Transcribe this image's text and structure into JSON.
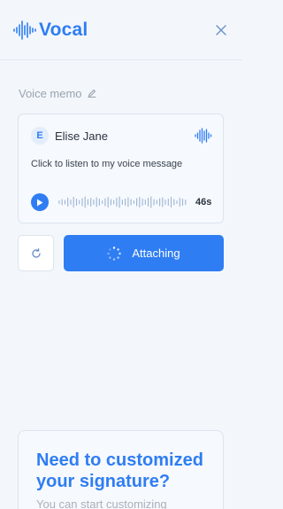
{
  "app": {
    "name": "Vocal"
  },
  "memo": {
    "label": "Voice memo"
  },
  "message_card": {
    "avatar_initial": "E",
    "sender_name": "Elise Jane",
    "message_text": "Click to listen to my voice message",
    "duration": "46s"
  },
  "actions": {
    "attach_label": "Attaching"
  },
  "promo": {
    "title": "Need to customized your signature?",
    "subtitle": "You can start customizing"
  },
  "colors": {
    "accent": "#2f7df3",
    "background": "#f3f7fc",
    "border": "#dde4ed",
    "muted_text": "#9aa3ae"
  },
  "icons": {
    "logo": "waveform-logo-icon",
    "close": "close-icon",
    "edit": "pencil-icon",
    "card_wave": "waveform-icon",
    "play": "play-icon",
    "reset": "refresh-icon",
    "spinner": "loading-spinner-icon"
  }
}
